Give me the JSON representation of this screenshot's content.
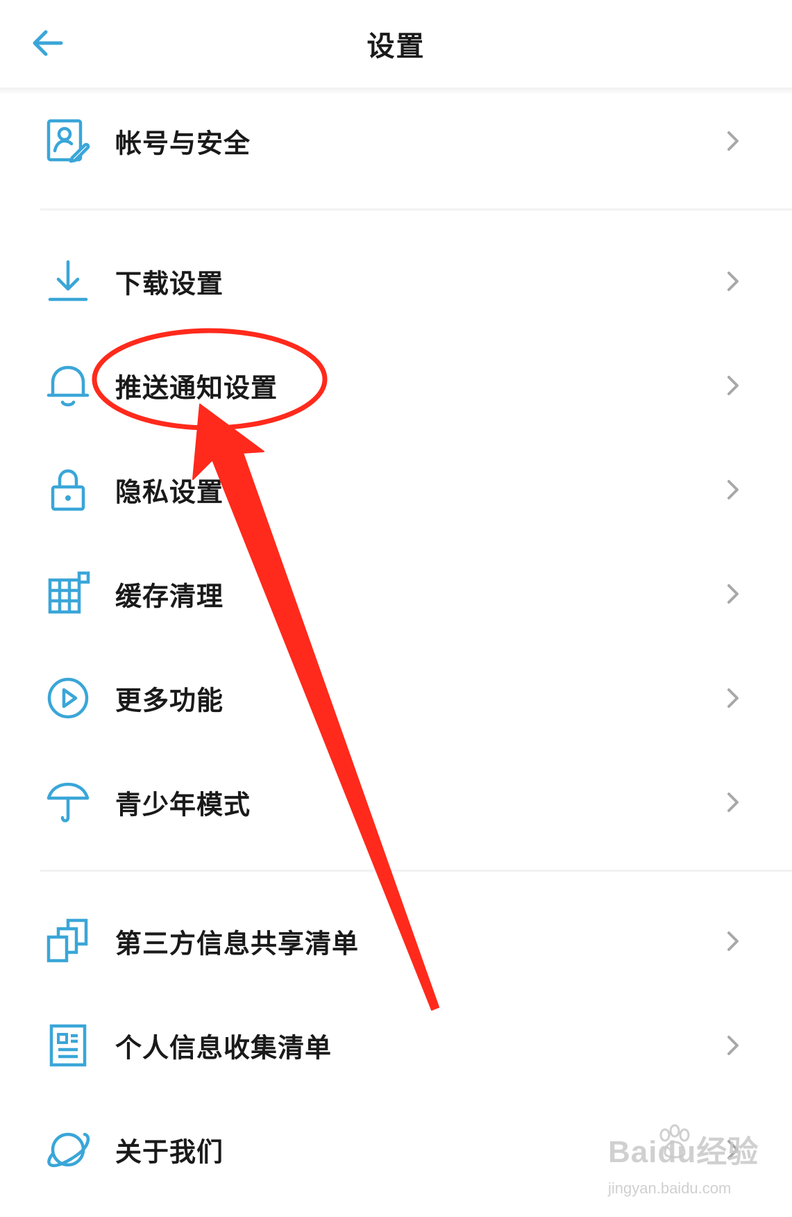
{
  "header": {
    "title": "设置",
    "back_icon": "back-arrow-icon"
  },
  "colors": {
    "accent": "#3aa6d8",
    "text": "#1a1a1a",
    "chevron": "#a8a8a8",
    "annotation": "#ff2a1c"
  },
  "settings": {
    "items": [
      {
        "label": "帐号与安全",
        "icon": "account-security-icon"
      },
      {
        "label": "下载设置",
        "icon": "download-icon"
      },
      {
        "label": "推送通知设置",
        "icon": "bell-icon"
      },
      {
        "label": "隐私设置",
        "icon": "lock-icon"
      },
      {
        "label": "缓存清理",
        "icon": "grid-icon"
      },
      {
        "label": "更多功能",
        "icon": "play-circle-icon"
      },
      {
        "label": "青少年模式",
        "icon": "umbrella-icon"
      },
      {
        "label": "第三方信息共享清单",
        "icon": "copy-icon"
      },
      {
        "label": "个人信息收集清单",
        "icon": "document-icon"
      },
      {
        "label": "关于我们",
        "icon": "planet-icon"
      }
    ]
  },
  "watermark": {
    "logo_text": "Baidu经验",
    "url_text": "jingyan.baidu.com"
  }
}
